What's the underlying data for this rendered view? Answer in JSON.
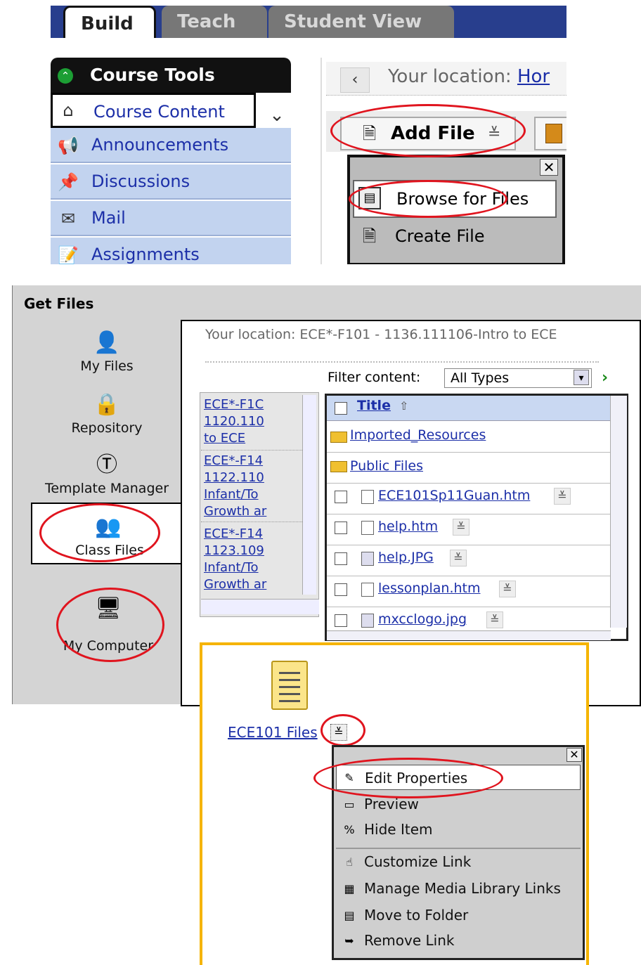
{
  "panel1": {
    "tabs": [
      "Build",
      "Teach",
      "Student View"
    ],
    "course_tools_title": "Course Tools",
    "nav_items": [
      {
        "label": "Course Content",
        "icon": "home-icon"
      },
      {
        "label": "Announcements",
        "icon": "megaphone-icon"
      },
      {
        "label": "Discussions",
        "icon": "pin-icon"
      },
      {
        "label": "Mail",
        "icon": "envelope-icon"
      },
      {
        "label": "Assignments",
        "icon": "assignment-icon"
      }
    ],
    "location_prefix": "Your location:",
    "location_link": "Hor",
    "add_file_label": "Add File",
    "dropdown": [
      "Browse for Files",
      "Create File"
    ]
  },
  "panel2": {
    "title": "Get Files",
    "sources": [
      "My Files",
      "Repository",
      "Template Manager",
      "Class Files",
      "My Computer"
    ],
    "location": "Your location: ECE*-F101 - 1136.111106-Intro to ECE",
    "filter_label": "Filter content:",
    "filter_value": "All Types",
    "tree_nodes": [
      {
        "line1": "ECE*-F1C",
        "line2": "1120.110",
        "line3": "to ECE"
      },
      {
        "line1": "ECE*-F14",
        "line2": "1122.110",
        "line3": "Infant/To",
        "line4": "Growth ar"
      },
      {
        "line1": "ECE*-F14",
        "line2": "1123.109",
        "line3": "Infant/To",
        "line4": "Growth ar"
      }
    ],
    "list_header": "Title",
    "files": [
      {
        "name": "Imported_Resources",
        "type": "folder"
      },
      {
        "name": "Public Files",
        "type": "folder"
      },
      {
        "name": "ECE101Sp11Guan.htm",
        "type": "file"
      },
      {
        "name": "help.htm",
        "type": "file"
      },
      {
        "name": "help.JPG",
        "type": "image"
      },
      {
        "name": "lessonplan.htm",
        "type": "file"
      },
      {
        "name": "mxcclogo.jpg",
        "type": "image"
      }
    ]
  },
  "panel3": {
    "item_label": "ECE101 Files",
    "menu": [
      "Edit Properties",
      "Preview",
      "Hide Item",
      "Customize Link",
      "Manage Media Library Links",
      "Move to Folder",
      "Remove Link"
    ]
  },
  "colors": {
    "accent_red": "#e0141e",
    "nav_blue": "#283e8d",
    "frame_yellow": "#f5b400"
  }
}
